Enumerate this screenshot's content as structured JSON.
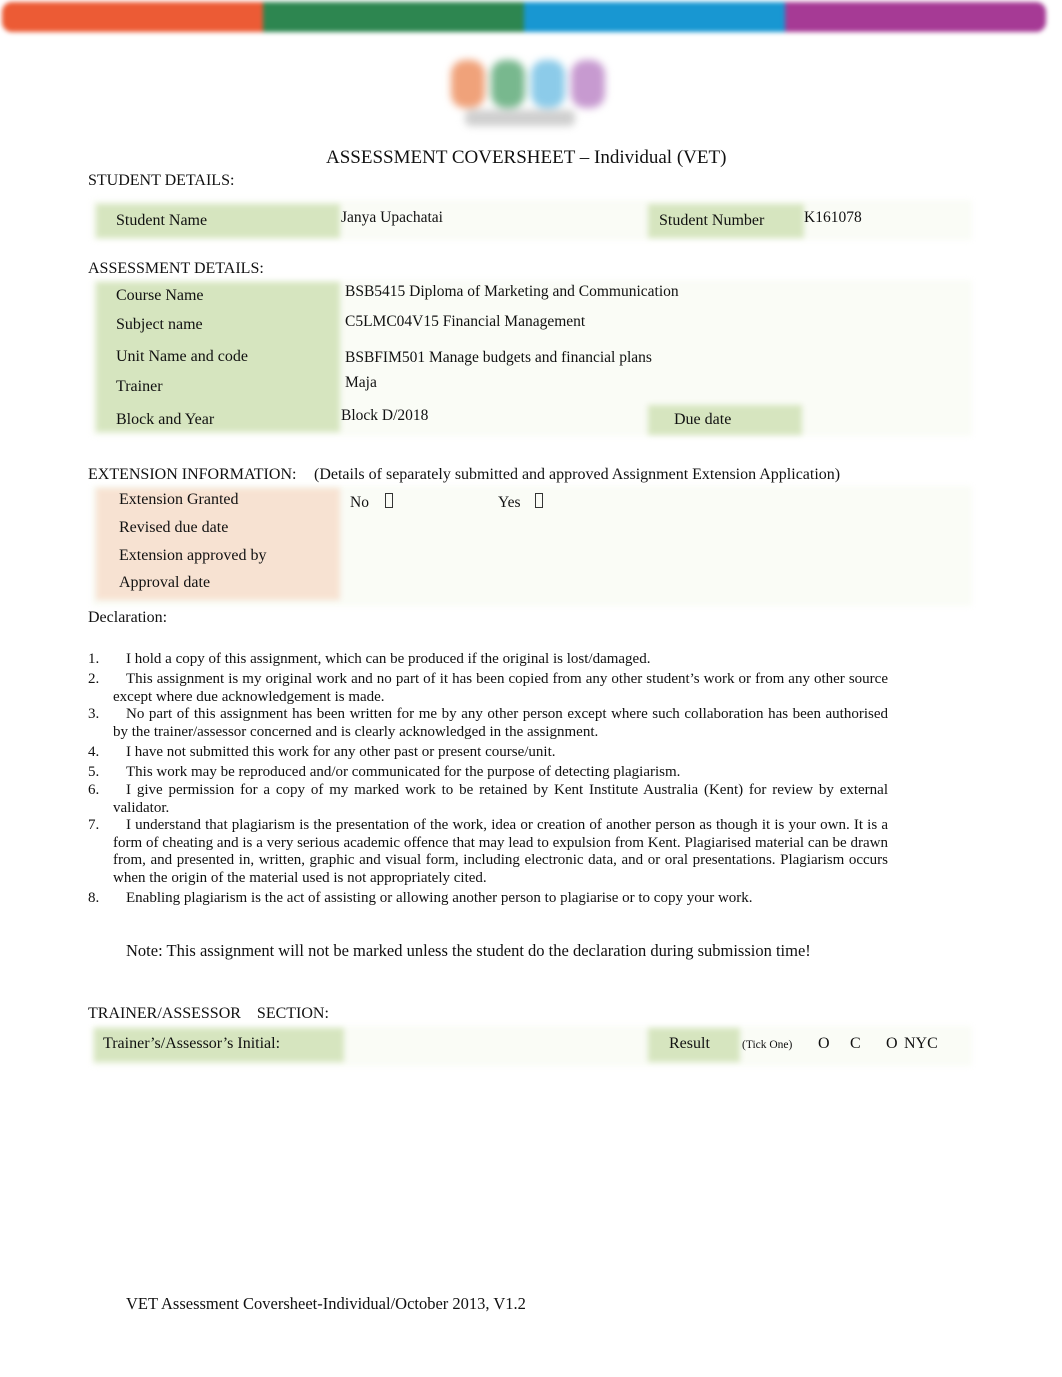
{
  "header": {
    "brand_colors": [
      "#ec5b35",
      "#2d8650",
      "#1897d2",
      "#a63a95"
    ],
    "logo_name": "Kent Institute logo",
    "title": "ASSESSMENT COVERSHEET – Individual (VET)"
  },
  "student_details": {
    "heading": "STUDENT DETAILS:",
    "student_name_label": "Student Name",
    "student_name_value": "Janya Upachatai",
    "student_number_label": "Student Number",
    "student_number_value": "K161078"
  },
  "assessment_details": {
    "heading": "ASSESSMENT DETAILS:",
    "rows": [
      {
        "label": "Course Name",
        "value": "BSB5415 Diploma of Marketing and Communication"
      },
      {
        "label": "Subject name",
        "value": "C5LMC04V15 Financial Management"
      },
      {
        "label": "Unit Name and code",
        "value": "BSBFIM501 Manage budgets and financial plans"
      },
      {
        "label": "Trainer",
        "value": "Maja"
      },
      {
        "label": "Block and Year",
        "value": "Block D/2018"
      }
    ],
    "due_date_label": "Due date",
    "due_date_value": ""
  },
  "extension": {
    "heading": "EXTENSION INFORMATION:",
    "subheading": "(Details of separately submitted and approved Assignment Extension Application)",
    "rows": [
      {
        "label": "Extension Granted"
      },
      {
        "label": "Revised due date",
        "value": ""
      },
      {
        "label": "Extension approved by",
        "value": ""
      },
      {
        "label": "Approval date",
        "value": ""
      }
    ],
    "no_label": "No",
    "yes_label": "Yes",
    "no_checked": false,
    "yes_checked": false
  },
  "declaration": {
    "heading": "Declaration:",
    "items": [
      {
        "num": "1.",
        "text": "I hold a copy of this assignment, which can be produced if the original is lost/damaged."
      },
      {
        "num": "2.",
        "text": "This assignment is my original work and no part of it has been copied from any other student’s work or from any other source except where due acknowledgement is made."
      },
      {
        "num": "3.",
        "text": "No part of this assignment has been written for me by any other person except where such collaboration has been authorised by the trainer/assessor concerned and is clearly acknowledged in the assignment."
      },
      {
        "num": "4.",
        "text": "I have not submitted this work for any other past or present course/unit."
      },
      {
        "num": "5.",
        "text": "This work may be reproduced and/or communicated for the purpose of detecting plagiarism."
      },
      {
        "num": "6.",
        "text": "I give permission for a copy of my marked work to be retained by Kent Institute Australia (Kent) for review by external validator."
      },
      {
        "num": "7.",
        "text": "I understand that plagiarism is the presentation of the work, idea or creation of another person as though it is your own. It is a form of cheating and is a very serious academic offence that may lead to expulsion from Kent. Plagiarised material can be drawn from, and presented in, written, graphic and visual form, including electronic data, and or oral presentations. Plagiarism occurs when the origin of the material used is not appropriately cited."
      },
      {
        "num": "8.",
        "text": "Enabling plagiarism is the act of assisting or allowing another person to plagiarise or to copy your work."
      }
    ],
    "note": "Note: This assignment will not be marked unless the student do the declaration during submission time!"
  },
  "trainer_section": {
    "heading": "TRAINER/ASSESSOR    SECTION:",
    "initial_label": "Trainer’s/Assessor’s Initial:",
    "initial_value": "",
    "result_label": "Result",
    "tick_one": "(Tick One)",
    "option_c_mark": "O",
    "option_c_label": "C",
    "option_nyc_mark": "O",
    "option_nyc_label": "NYC"
  },
  "footer": {
    "text": "VET Assessment Coversheet-Individual/October 2013, V1.2"
  }
}
